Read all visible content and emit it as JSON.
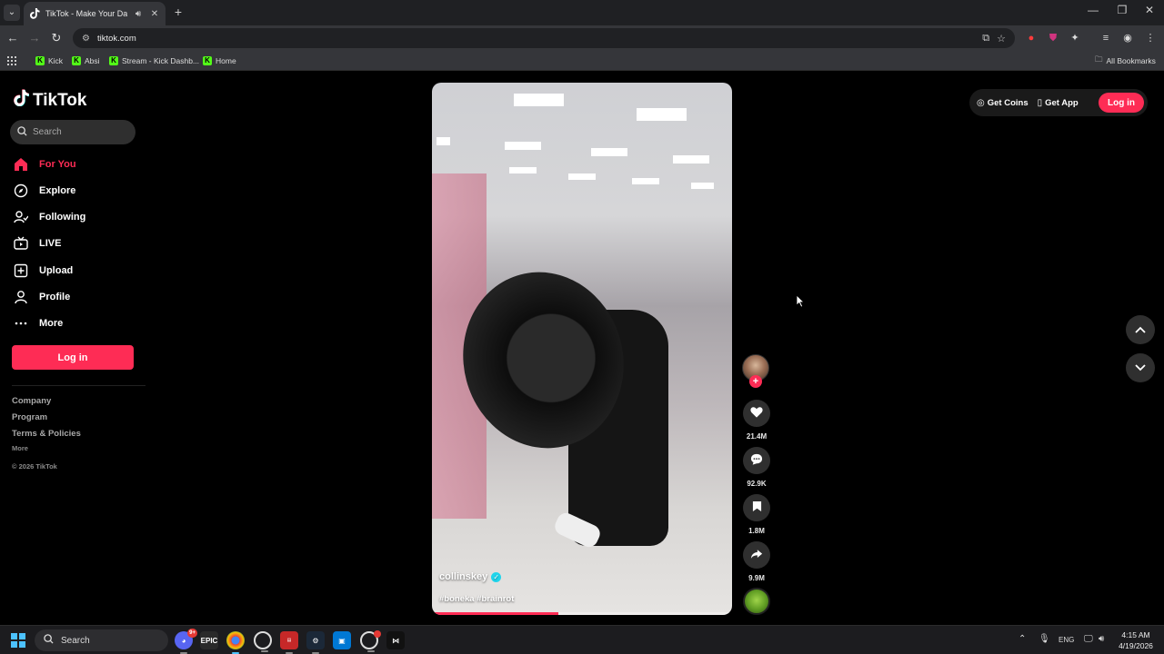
{
  "browser": {
    "tab_title": "TikTok - Make Your Day",
    "url": "tiktok.com",
    "bookmarks": [
      "Kick",
      "Absi",
      "Stream - Kick Dashb...",
      "Home"
    ],
    "all_bookmarks": "All Bookmarks"
  },
  "sidebar": {
    "logo_text": "TikTok",
    "search_placeholder": "Search",
    "nav": [
      {
        "label": "For You",
        "icon": "home-icon"
      },
      {
        "label": "Explore",
        "icon": "compass-icon"
      },
      {
        "label": "Following",
        "icon": "following-icon"
      },
      {
        "label": "LIVE",
        "icon": "live-tv-icon"
      },
      {
        "label": "Upload",
        "icon": "upload-plus-icon"
      },
      {
        "label": "Profile",
        "icon": "profile-icon"
      },
      {
        "label": "More",
        "icon": "more-dots-icon"
      }
    ],
    "login_label": "Log in",
    "footer": {
      "company": "Company",
      "program": "Program",
      "terms": "Terms & Policies",
      "more": "More",
      "copyright": "© 2026 TikTok"
    }
  },
  "video": {
    "author": "collinskey",
    "hashtags": "#boneka #brainrot",
    "progress": 0.42,
    "likes": "21.4M",
    "comments": "92.9K",
    "saves": "1.8M",
    "shares": "9.9M"
  },
  "topbar": {
    "get_coins": "Get Coins",
    "get_app": "Get App",
    "login_label": "Log in"
  },
  "taskbar": {
    "search_label": "Search",
    "discord_badge": "9+",
    "language": "ENG",
    "time": "4:15 AM",
    "date": "4/19/2026"
  },
  "colors": {
    "accent": "#fe2c55",
    "background": "#000000",
    "verified": "#20d5ec"
  }
}
